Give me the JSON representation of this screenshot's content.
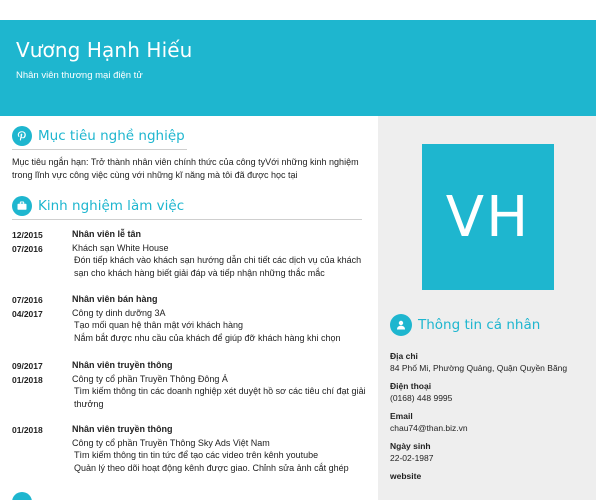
{
  "header": {
    "name": "Vương Hạnh Hiếu",
    "job_title": "Nhân viên thương mại điện tử"
  },
  "colors": {
    "accent": "#1eb6cf",
    "side_bg": "#eeeeee"
  },
  "objective": {
    "icon": "pinterest-icon",
    "title": "Mục tiêu nghề nghiệp",
    "text": "Mục tiêu ngắn hạn: Trở thành nhân viên chính thức của công tyVới những kinh nghiệm trong lĩnh vực công việc cùng với những kĩ năng mà tôi đã được học tại"
  },
  "experience": {
    "icon": "briefcase-icon",
    "title": "Kinh nghiệm làm việc",
    "items": [
      {
        "start": "12/2015",
        "end": "07/2016",
        "role": "Nhân viên lễ tân",
        "company": "Khách sạn White House",
        "desc": "Đón tiếp khách vào khách sạn hướng dẫn chi tiết các dịch vụ của khách sạn cho khách hàng  biết giải đáp và tiếp nhận những thắc mắc"
      },
      {
        "start": "07/2016",
        "end": "04/2017",
        "role": "Nhân viên bán hàng",
        "company": "Công ty dinh dưỡng 3A",
        "desc": "Tạo mối quan hệ thân mật với khách hàng\nNắm bắt được nhu cầu của khách để giúp đỡ khách hàng khi chọn"
      },
      {
        "start": "09/2017",
        "end": "01/2018",
        "role": "Nhân viên truyền thông",
        "company": "Công ty cổ phần  Truyền Thông Đông Á",
        "desc": "Tìm kiếm thông tin các doanh nghiệp xét duyệt hồ sơ các tiêu chí đạt giải thưởng"
      },
      {
        "start": "01/2018",
        "end": "",
        "role": "Nhân viên truyền thông",
        "company": "Công ty cổ phần  Truyền Thông Sky Ads Việt Nam",
        "desc": "Tìm kiếm thông tin tin tức để tạo các video trên kênh youtube\nQuản lý theo dõi hoạt động kênh được giao. Chỉnh sửa ảnh cắt ghép"
      }
    ]
  },
  "avatar": {
    "initials": "VH"
  },
  "personal": {
    "icon": "person-icon",
    "title": "Thông tin cá nhân",
    "fields": [
      {
        "label": "Địa chỉ",
        "value": "84 Phố Mi, Phường Quảng, Quận Quyền Băng"
      },
      {
        "label": "Điện thoại",
        "value": "(0168) 448 9995"
      },
      {
        "label": "Email",
        "value": "chau74@than.biz.vn"
      },
      {
        "label": "Ngày sinh",
        "value": "22-02-1987"
      },
      {
        "label": "website",
        "value": ""
      }
    ]
  }
}
